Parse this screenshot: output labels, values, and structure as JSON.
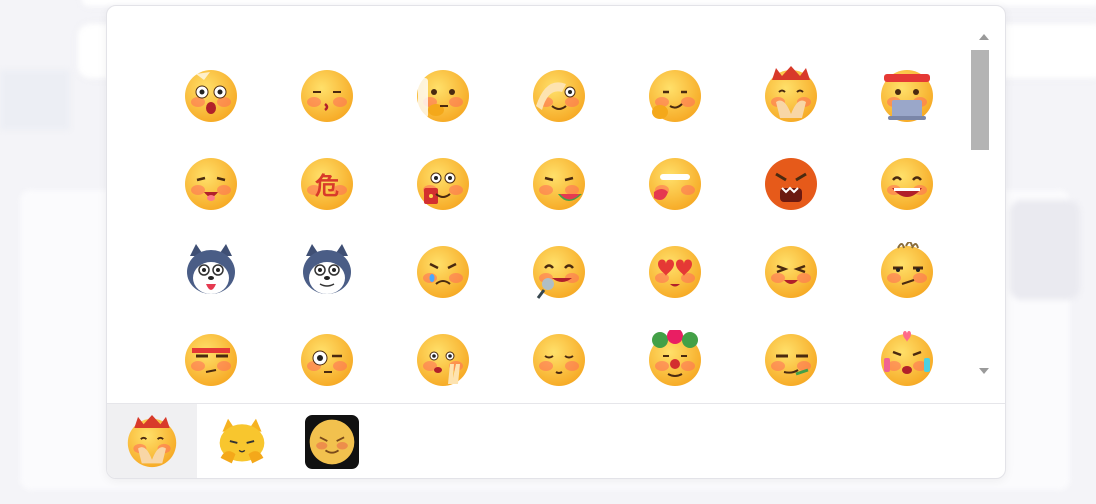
{
  "emoji_grid": {
    "items": [
      {
        "name": "shocked-bald-emoji",
        "type": "face-shock"
      },
      {
        "name": "kissing-emoji",
        "type": "face-kiss"
      },
      {
        "name": "thinking-hand-emoji",
        "type": "face-think"
      },
      {
        "name": "facepalm-emoji",
        "type": "face-palm"
      },
      {
        "name": "pondering-emoji",
        "type": "face-ponder"
      },
      {
        "name": "praying-king-emoji",
        "type": "face-king"
      },
      {
        "name": "laptop-headband-emoji",
        "type": "face-laptop"
      },
      {
        "name": "tongue-out-emoji",
        "type": "face-tongue"
      },
      {
        "name": "danger-emoji",
        "type": "face-danger"
      },
      {
        "name": "red-envelope-emoji",
        "type": "face-envelope"
      },
      {
        "name": "watermelon-eating-emoji",
        "type": "face-melon"
      },
      {
        "name": "vomit-emoji",
        "type": "face-vomit"
      },
      {
        "name": "angry-roar-emoji",
        "type": "face-angry"
      },
      {
        "name": "big-laugh-emoji",
        "type": "face-laugh"
      },
      {
        "name": "husky-tongue-emoji",
        "type": "dog-tongue"
      },
      {
        "name": "husky-smile-emoji",
        "type": "dog-smile"
      },
      {
        "name": "crying-angry-emoji",
        "type": "face-cryangry"
      },
      {
        "name": "microphone-emoji",
        "type": "face-mic"
      },
      {
        "name": "heart-eyes-emoji",
        "type": "face-heart"
      },
      {
        "name": "happy-squint-emoji",
        "type": "face-squint"
      },
      {
        "name": "hair-up-emoji",
        "type": "face-hair"
      },
      {
        "name": "unamused-emoji",
        "type": "face-unamused"
      },
      {
        "name": "one-eye-emoji",
        "type": "face-oneeye"
      },
      {
        "name": "peace-hand-emoji",
        "type": "face-peace"
      },
      {
        "name": "blushing-emoji",
        "type": "face-blush"
      },
      {
        "name": "clown-emoji",
        "type": "face-clown"
      },
      {
        "name": "smirk-emoji",
        "type": "face-smirk"
      },
      {
        "name": "cheering-emoji",
        "type": "face-cheer"
      }
    ]
  },
  "tabs": [
    {
      "name": "tab-classic",
      "type": "face-king",
      "active": true
    },
    {
      "name": "tab-cat",
      "type": "cat"
    },
    {
      "name": "tab-blush",
      "type": "face-blushtab"
    }
  ],
  "colors": {
    "face": "#f9c233",
    "cheek": "#ff6b5a",
    "accent": "#e53935"
  }
}
